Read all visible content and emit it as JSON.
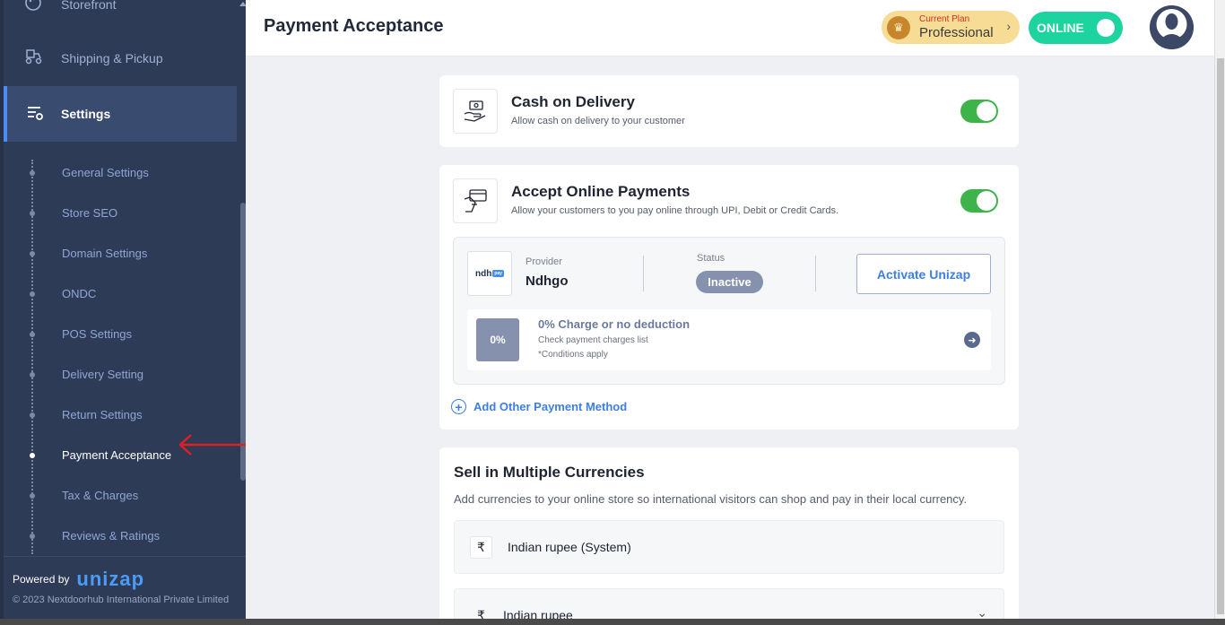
{
  "sidebar": {
    "nav_items": [
      {
        "label": "Storefront",
        "icon": "palette-icon"
      },
      {
        "label": "Shipping & Pickup",
        "icon": "scooter-icon"
      },
      {
        "label": "Settings",
        "icon": "settings-sliders-icon"
      }
    ],
    "sub_items": [
      {
        "label": "General Settings",
        "active": false
      },
      {
        "label": "Store SEO",
        "active": false
      },
      {
        "label": "Domain Settings",
        "active": false
      },
      {
        "label": "ONDC",
        "active": false
      },
      {
        "label": "POS Settings",
        "active": false
      },
      {
        "label": "Delivery Setting",
        "active": false
      },
      {
        "label": "Return Settings",
        "active": false
      },
      {
        "label": "Payment Acceptance",
        "active": true
      },
      {
        "label": "Tax & Charges",
        "active": false
      },
      {
        "label": "Reviews & Ratings",
        "active": false
      }
    ],
    "footer": {
      "powered_by": "Powered by",
      "brand": "unizap",
      "copyright": "© 2023 Nextdoorhub International Private Limited"
    }
  },
  "header": {
    "title": "Payment Acceptance",
    "plan": {
      "label": "Current Plan",
      "name": "Professional"
    },
    "status_toggle": "ONLINE",
    "status_on": true
  },
  "cod": {
    "title": "Cash on Delivery",
    "description": "Allow cash on delivery to your customer",
    "enabled": true
  },
  "online_payments": {
    "title": "Accept Online Payments",
    "description": "Allow your customers to you pay online through UPI, Debit or Credit Cards.",
    "enabled": true,
    "provider": {
      "logo_text": "ndh",
      "logo_tag": "pay",
      "label": "Provider",
      "name": "Ndhgo",
      "status_label": "Status",
      "status": "Inactive",
      "action": "Activate Unizap"
    },
    "charges": {
      "badge": "0%",
      "title": "0% Charge or no deduction",
      "subtitle": "Check payment charges list",
      "note": "*Conditions apply"
    },
    "add_method": "Add Other Payment Method"
  },
  "currencies": {
    "title": "Sell in Multiple Currencies",
    "description": "Add currencies to your online store so international visitors can shop and pay in their local currency.",
    "rows": [
      {
        "symbol": "₹",
        "name": "Indian rupee (System)"
      },
      {
        "symbol": "₹",
        "name": "Indian rupee"
      }
    ]
  },
  "colors": {
    "sidebar_bg": "#2e3b57",
    "accent_blue": "#3d7fe0",
    "toggle_green": "#3cb44a",
    "online_teal": "#1dd3a0",
    "plan_gold": "#f7dc96",
    "annotation_red": "#e02020"
  }
}
